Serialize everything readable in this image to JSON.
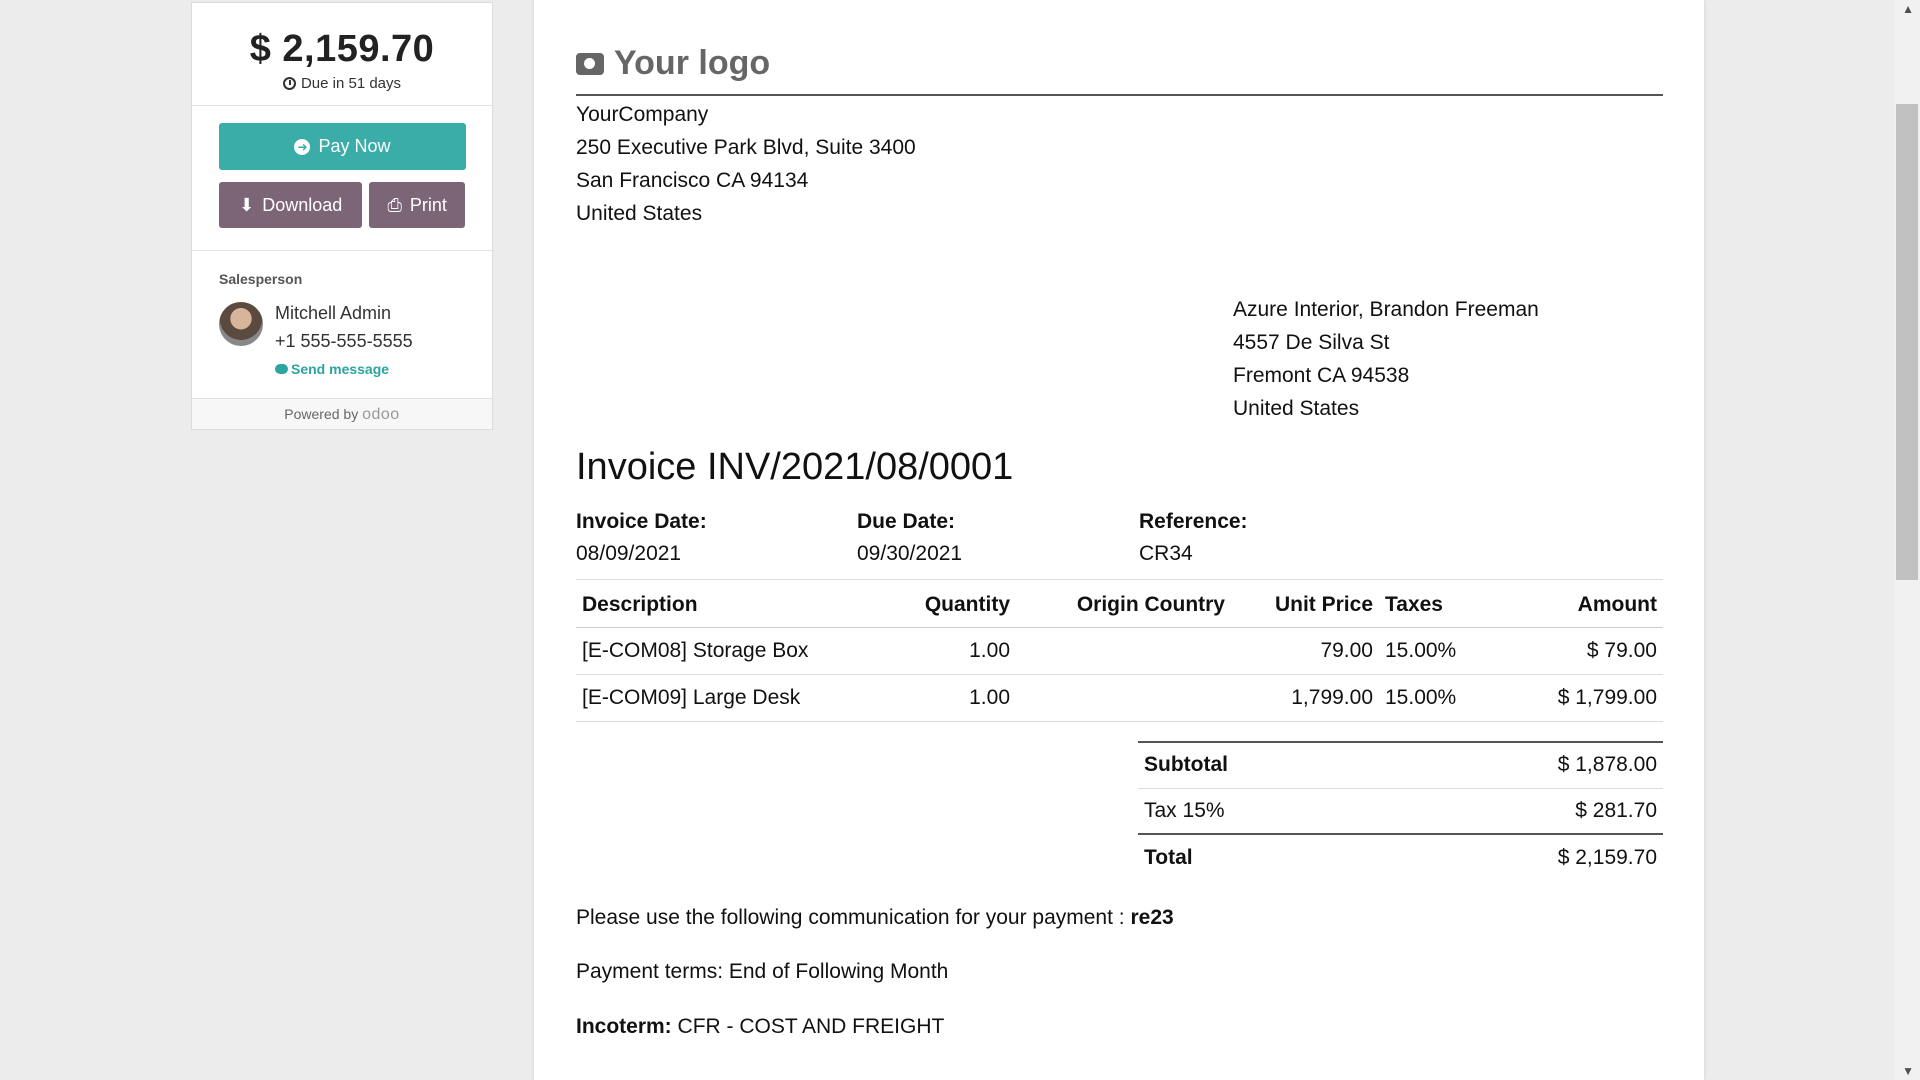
{
  "sidebar": {
    "amount": "$ 2,159.70",
    "due_text": "Due in 51 days",
    "pay_label": "Pay Now",
    "download_label": "Download",
    "print_label": "Print",
    "salesperson_title": "Salesperson",
    "salesperson_name": "Mitchell Admin",
    "salesperson_phone": "+1 555-555-5555",
    "send_message_label": "Send message",
    "powered_by": "Powered by",
    "powered_brand": "odoo"
  },
  "invoice": {
    "logo_text": "Your logo",
    "company": [
      "YourCompany",
      "250 Executive Park Blvd, Suite 3400",
      "San Francisco CA 94134",
      "United States"
    ],
    "customer": [
      "Azure Interior, Brandon Freeman",
      "4557 De Silva St",
      "Fremont CA 94538",
      "United States"
    ],
    "title": "Invoice INV/2021/08/0001",
    "invoice_date_label": "Invoice Date:",
    "invoice_date": "08/09/2021",
    "due_date_label": "Due Date:",
    "due_date": "09/30/2021",
    "reference_label": "Reference:",
    "reference": "CR34",
    "columns": [
      "Description",
      "Quantity",
      "Origin Country",
      "Unit Price",
      "Taxes",
      "Amount"
    ],
    "lines": [
      {
        "description": "[E-COM08] Storage Box",
        "quantity": "1.00",
        "origin": "",
        "unit_price": "79.00",
        "taxes": "15.00%",
        "amount": "$ 79.00"
      },
      {
        "description": "[E-COM09] Large Desk",
        "quantity": "1.00",
        "origin": "",
        "unit_price": "1,799.00",
        "taxes": "15.00%",
        "amount": "$ 1,799.00"
      }
    ],
    "subtotal_label": "Subtotal",
    "subtotal": "$ 1,878.00",
    "tax_label": "Tax 15%",
    "tax": "$ 281.70",
    "total_label": "Total",
    "total": "$ 2,159.70",
    "communication_text": "Please use the following communication for your payment :",
    "communication_ref": "re23",
    "payment_terms": "Payment terms: End of Following Month",
    "incoterm_label": "Incoterm:",
    "incoterm": "CFR - COST AND FREIGHT"
  }
}
